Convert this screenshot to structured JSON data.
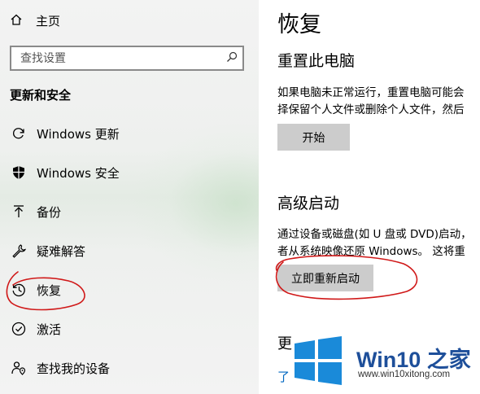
{
  "sidebar": {
    "home": {
      "icon": "home-icon",
      "label": "主页"
    },
    "search": {
      "placeholder": "查找设置",
      "icon": "search-icon"
    },
    "section_title": "更新和安全",
    "items": [
      {
        "icon": "refresh-icon",
        "label": "Windows 更新"
      },
      {
        "icon": "shield-icon",
        "label": "Windows 安全"
      },
      {
        "icon": "upload-arrow-icon",
        "label": "备份"
      },
      {
        "icon": "wrench-icon",
        "label": "疑难解答"
      },
      {
        "icon": "history-icon",
        "label": "恢复",
        "selected": true
      },
      {
        "icon": "check-circle-icon",
        "label": "激活"
      },
      {
        "icon": "person-location-icon",
        "label": "查找我的设备"
      }
    ]
  },
  "main": {
    "title": "恢复",
    "reset": {
      "heading": "重置此电脑",
      "desc_line1": "如果电脑未正常运行，重置电脑可能会",
      "desc_line2": "择保留个人文件或删除个人文件，然后",
      "button": "开始"
    },
    "advanced": {
      "heading": "高级启动",
      "desc_line1": "通过设备或磁盘(如 U 盘或 DVD)启动，",
      "desc_line2": "者从系统映像还原 Windows。 这将重",
      "button": "立即重新启动"
    },
    "cut_heading": "更",
    "cut_link": "了"
  },
  "watermark": {
    "title": "Win10 之家",
    "url": "www.win10xitong.com",
    "colors": [
      "#1e4f9a",
      "#1a8ad9"
    ]
  },
  "annotation_color": "#d01818"
}
